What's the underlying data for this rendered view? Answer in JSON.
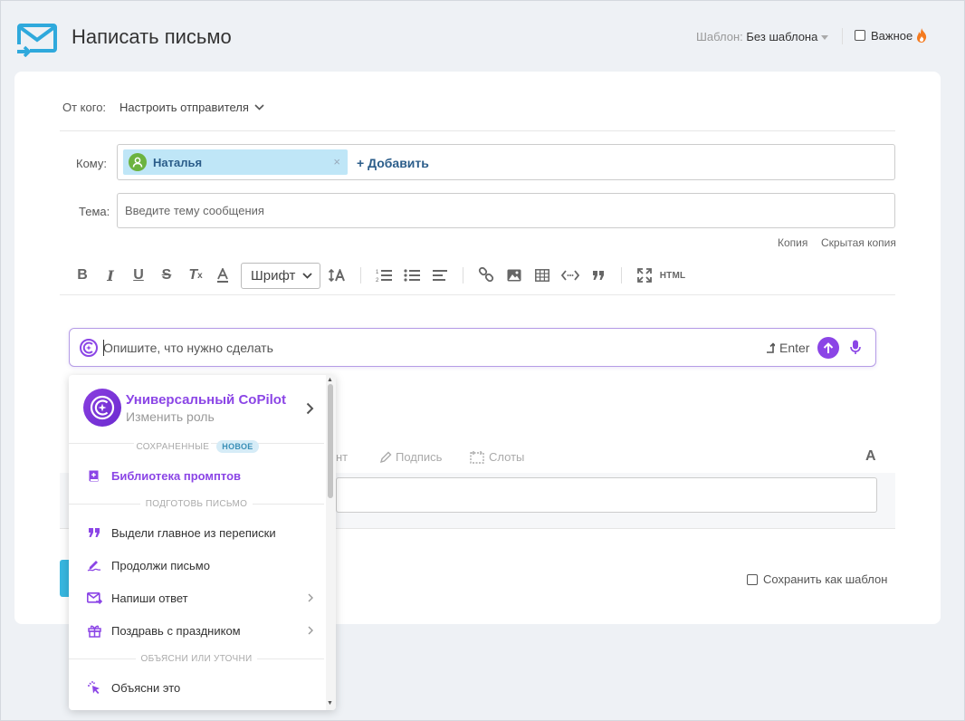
{
  "header": {
    "title": "Написать письмо",
    "template_label": "Шаблон:",
    "template_value": "Без шаблона",
    "important_label": "Важное"
  },
  "form": {
    "from_label": "От кого:",
    "from_value": "Настроить отправителя",
    "to_label": "Кому:",
    "recipient": "Наталья",
    "add_label": "+ Добавить",
    "subject_label": "Тема:",
    "subject_placeholder": "Введите тему сообщения",
    "cc_label": "Копия",
    "bcc_label": "Скрытая копия"
  },
  "toolbar": {
    "font_label": "Шрифт",
    "html_label": "HTML"
  },
  "copilot": {
    "placeholder": "Опишите, что нужно сделать",
    "enter_label": "Enter"
  },
  "behind": {
    "tab_partial": "нт",
    "signature_label": "Подпись",
    "slots_label": "Слоты",
    "text_tool": "A",
    "save_template_label": "Сохранить как шаблон"
  },
  "dropdown": {
    "name": "Универсальный CoPilot",
    "role": "Изменить роль",
    "section_saved": "СОХРАНЕННЫЕ",
    "badge_new": "НОВОЕ",
    "library": "Библиотека промптов",
    "section_prepare": "ПОДГОТОВЬ ПИСЬМО",
    "items_prepare": [
      {
        "label": "Выдели главное из переписки",
        "icon": "quote-icon"
      },
      {
        "label": "Продолжи письмо",
        "icon": "signature-pen-icon"
      },
      {
        "label": "Напиши ответ",
        "icon": "mail-reply-icon"
      },
      {
        "label": "Поздравь с праздником",
        "icon": "gift-icon"
      }
    ],
    "section_explain": "ОБЪЯСНИ ИЛИ УТОЧНИ",
    "items_explain": [
      {
        "label": "Объясни это",
        "icon": "cursor-click-icon"
      }
    ]
  },
  "colors": {
    "accent_purple": "#8b45e6",
    "accent_blue": "#38b7e0",
    "chip_bg": "#bfe6f7"
  }
}
